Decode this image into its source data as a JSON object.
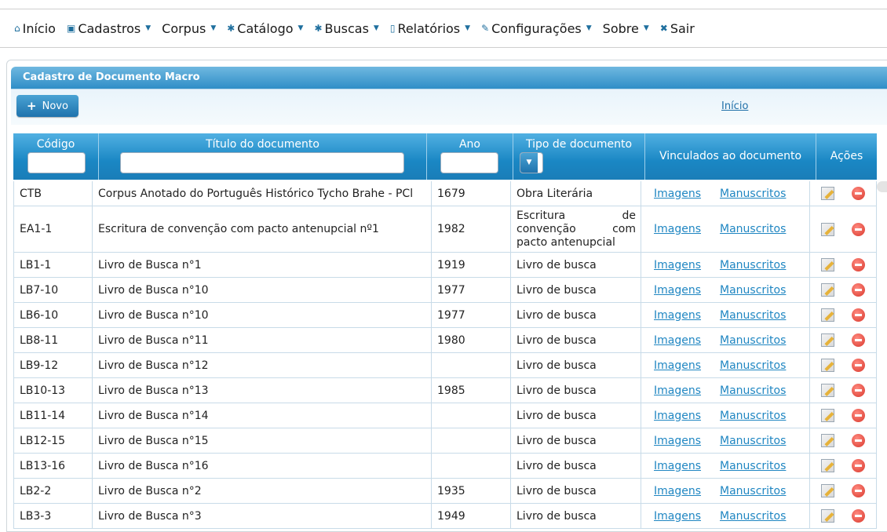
{
  "nav": [
    {
      "icon": "home-icon",
      "glyph": "⌂",
      "label": "Início",
      "caret": false
    },
    {
      "icon": "card-icon",
      "glyph": "▣",
      "label": "Cadastros",
      "caret": true
    },
    {
      "icon": "",
      "glyph": "",
      "label": "Corpus",
      "caret": true
    },
    {
      "icon": "gear-icon",
      "glyph": "✱",
      "label": "Catálogo",
      "caret": true
    },
    {
      "icon": "gear-icon",
      "glyph": "✱",
      "label": "Buscas",
      "caret": true
    },
    {
      "icon": "document-icon",
      "glyph": "▯",
      "label": "Relatórios",
      "caret": true
    },
    {
      "icon": "wrench-icon",
      "glyph": "✎",
      "label": "Configurações",
      "caret": true
    },
    {
      "icon": "",
      "glyph": "",
      "label": "Sobre",
      "caret": true
    },
    {
      "icon": "close-icon",
      "glyph": "✖",
      "label": "Sair",
      "caret": false
    }
  ],
  "panel": {
    "title": "Cadastro de Documento Macro",
    "new_button": "Novo",
    "home_link": "Início"
  },
  "table": {
    "headers": {
      "codigo": "Código",
      "titulo": "Título do documento",
      "ano": "Ano",
      "tipo": "Tipo de documento",
      "vinculados": "Vinculados ao documento",
      "acoes": "Ações"
    },
    "link_imagens": "Imagens",
    "link_manuscritos": "Manuscritos",
    "rows": [
      {
        "codigo": "CTB",
        "titulo": "Corpus Anotado do Português Histórico Tycho Brahe - PCl",
        "ano": "1679",
        "tipo": "Obra Literária"
      },
      {
        "codigo": "EA1-1",
        "titulo": "Escritura de convenção com pacto antenupcial nº1",
        "ano": "1982",
        "tipo": "Escritura de convenção com pacto antenupcial"
      },
      {
        "codigo": "LB1-1",
        "titulo": "Livro de Busca n°1",
        "ano": "1919",
        "tipo": "Livro de busca"
      },
      {
        "codigo": "LB7-10",
        "titulo": "Livro de Busca n°10",
        "ano": "1977",
        "tipo": "Livro de busca"
      },
      {
        "codigo": "LB6-10",
        "titulo": "Livro de Busca n°10",
        "ano": "1977",
        "tipo": "Livro de busca"
      },
      {
        "codigo": "LB8-11",
        "titulo": "Livro de Busca n°11",
        "ano": "1980",
        "tipo": "Livro de busca"
      },
      {
        "codigo": "LB9-12",
        "titulo": "Livro de Busca n°12",
        "ano": "",
        "tipo": "Livro de busca"
      },
      {
        "codigo": "LB10-13",
        "titulo": "Livro de Busca n°13",
        "ano": "1985",
        "tipo": "Livro de busca"
      },
      {
        "codigo": "LB11-14",
        "titulo": "Livro de Busca n°14",
        "ano": "",
        "tipo": "Livro de busca"
      },
      {
        "codigo": "LB12-15",
        "titulo": "Livro de Busca n°15",
        "ano": "",
        "tipo": "Livro de busca"
      },
      {
        "codigo": "LB13-16",
        "titulo": "Livro de Busca n°16",
        "ano": "",
        "tipo": "Livro de busca"
      },
      {
        "codigo": "LB2-2",
        "titulo": "Livro de Busca n°2",
        "ano": "1935",
        "tipo": "Livro de busca"
      },
      {
        "codigo": "LB3-3",
        "titulo": "Livro de Busca n°3",
        "ano": "1949",
        "tipo": "Livro de busca"
      }
    ]
  }
}
